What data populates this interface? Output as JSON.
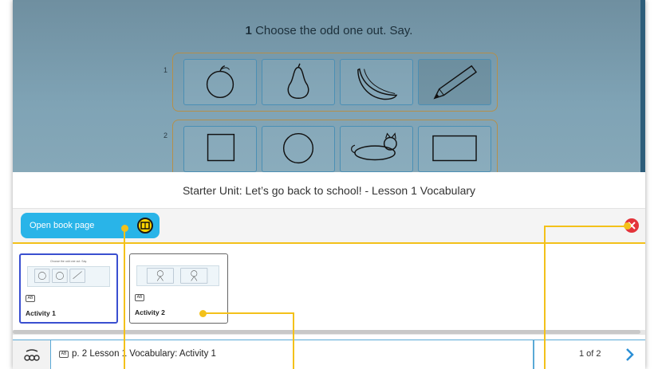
{
  "book_page": {
    "instruction_number": "1",
    "instruction_text": "Choose the odd one out. Say.",
    "rows": [
      {
        "number": "1",
        "items": [
          "apple-icon",
          "pear-icon",
          "banana-icon",
          "pencil-icon"
        ]
      },
      {
        "number": "2",
        "items": [
          "square-icon",
          "circle-icon",
          "cat-icon",
          "rectangle-icon"
        ]
      }
    ]
  },
  "title_bar": {
    "title": "Starter Unit: Let’s go back to school! - Lesson 1 Vocabulary"
  },
  "toolbar": {
    "open_book_label": "Open book page",
    "open_book_icon": "book-icon",
    "close_icon": "close-icon"
  },
  "thumbnails": [
    {
      "label": "Activity 1",
      "badge": "AB",
      "active": true
    },
    {
      "label": "Activity 2",
      "badge": "AB",
      "active": false
    }
  ],
  "footer": {
    "badge": "AB",
    "page_label": "p. 2  Lesson 1 Vocabulary: Activity 1",
    "page_count": "1  of  2"
  },
  "colors": {
    "accent_blue": "#29b4e8",
    "highlight_yellow": "#f3c11a",
    "close_red": "#e3343a",
    "active_border": "#3a4fd0"
  }
}
